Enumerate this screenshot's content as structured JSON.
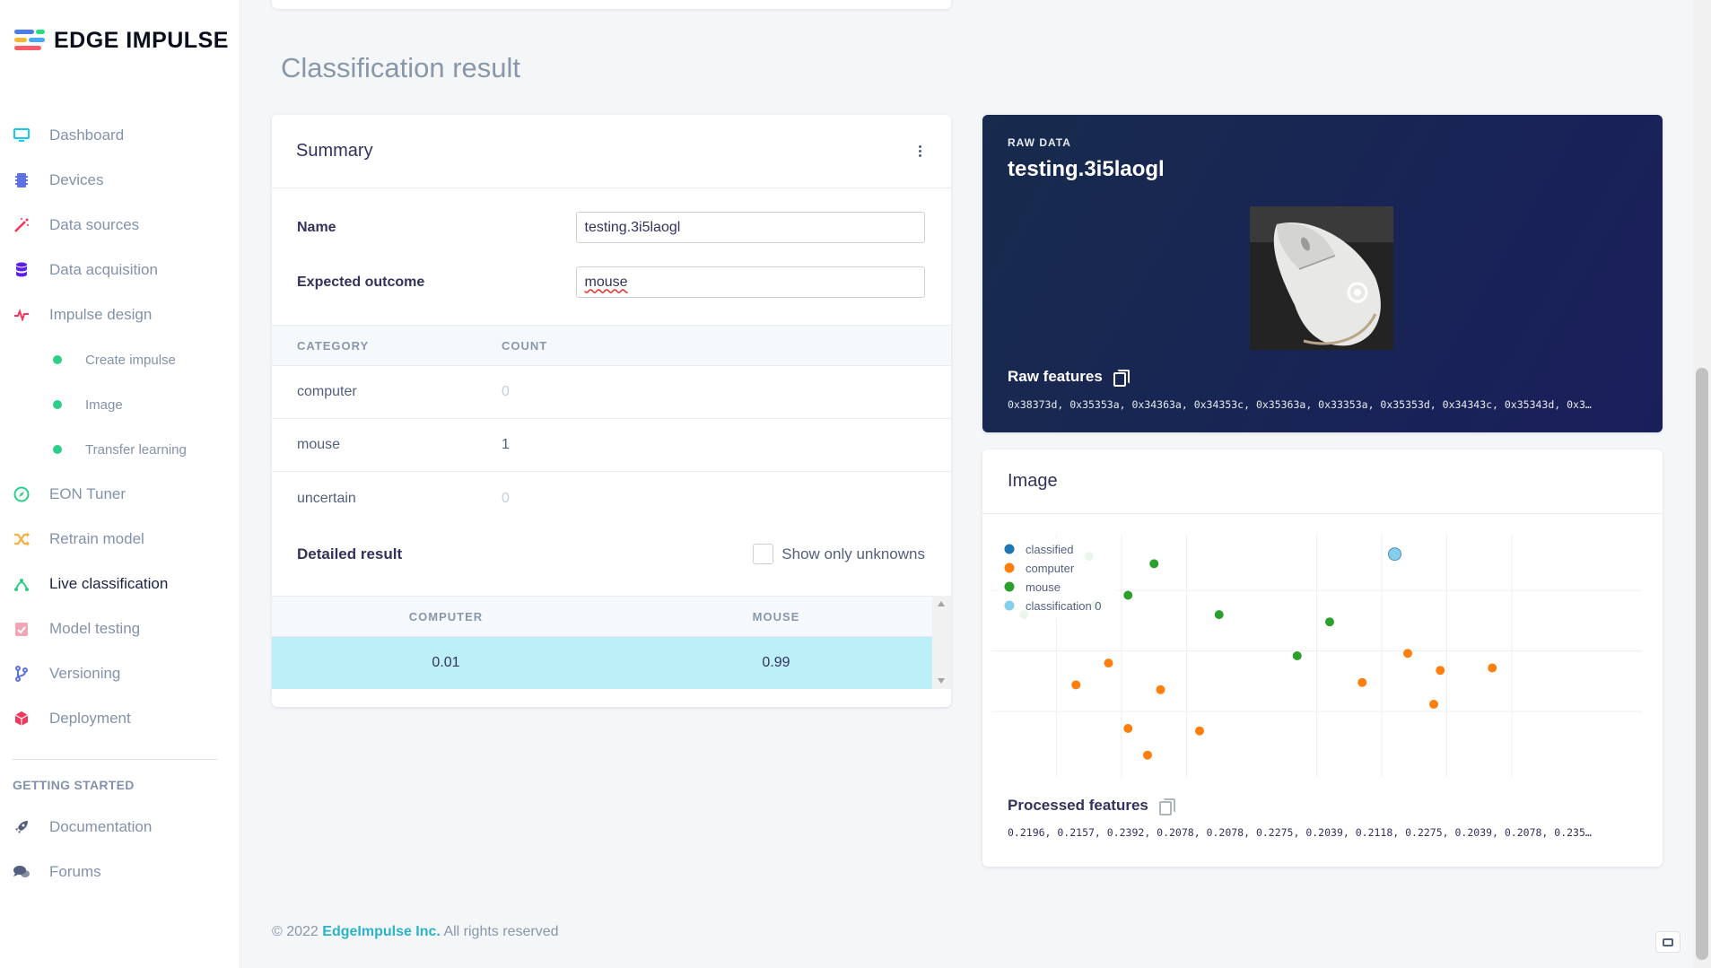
{
  "brand": {
    "name": "EDGE IMPULSE"
  },
  "sidebar": {
    "items": [
      {
        "label": "Dashboard",
        "icon": "monitor-icon",
        "color": "#11cdef"
      },
      {
        "label": "Devices",
        "icon": "chip-icon",
        "color": "#5e72e4"
      },
      {
        "label": "Data sources",
        "icon": "wand-icon",
        "color": "#f5365c"
      },
      {
        "label": "Data acquisition",
        "icon": "database-icon",
        "color": "#5e1fe4"
      },
      {
        "label": "Impulse design",
        "icon": "pulse-icon",
        "color": "#f5365c"
      }
    ],
    "subitems": [
      {
        "label": "Create impulse"
      },
      {
        "label": "Image"
      },
      {
        "label": "Transfer learning"
      }
    ],
    "items2": [
      {
        "label": "EON Tuner",
        "icon": "compass-icon",
        "color": "#2dce89"
      },
      {
        "label": "Retrain model",
        "icon": "shuffle-icon",
        "color": "#fbb140"
      },
      {
        "label": "Live classification",
        "icon": "nodes-icon",
        "color": "#2dce89"
      },
      {
        "label": "Model testing",
        "icon": "clipboard-check-icon",
        "color": "#f3a4b5"
      },
      {
        "label": "Versioning",
        "icon": "branch-icon",
        "color": "#5e72e4"
      },
      {
        "label": "Deployment",
        "icon": "cube-icon",
        "color": "#f5365c"
      }
    ],
    "section_title": "GETTING STARTED",
    "items3": [
      {
        "label": "Documentation",
        "icon": "rocket-icon",
        "color": "#525f7f"
      },
      {
        "label": "Forums",
        "icon": "chat-icon",
        "color": "#525f7f"
      }
    ]
  },
  "main": {
    "title": "Classification result",
    "summary": {
      "title": "Summary",
      "name_label": "Name",
      "name_value": "testing.3i5laogl",
      "expected_label": "Expected outcome",
      "expected_value": "mouse",
      "columns": [
        "CATEGORY",
        "COUNT"
      ],
      "rows": [
        {
          "category": "computer",
          "count": "0"
        },
        {
          "category": "mouse",
          "count": "1"
        },
        {
          "category": "uncertain",
          "count": "0"
        }
      ],
      "detailed_title": "Detailed result",
      "show_unknowns_label": "Show only unknowns",
      "show_unknowns_checked": false,
      "result_columns": [
        "COMPUTER",
        "MOUSE"
      ],
      "result_values": [
        "0.01",
        "0.99"
      ]
    },
    "raw": {
      "label": "RAW DATA",
      "title": "testing.3i5laogl",
      "features_title": "Raw features",
      "features": "0x38373d, 0x35353a, 0x34363a, 0x34353c, 0x35363a, 0x33353a, 0x35353d, 0x34343c, 0x35343d, 0x3…"
    },
    "image_card": {
      "title": "Image",
      "processed_title": "Processed features",
      "processed": "0.2196, 0.2157, 0.2392, 0.2078, 0.2078, 0.2275, 0.2039, 0.2118, 0.2275, 0.2039, 0.2078, 0.235…"
    }
  },
  "chart_data": {
    "type": "scatter",
    "grid": true,
    "legend_position": "top-left",
    "legend": [
      {
        "name": "classified",
        "color": "#1f77b4"
      },
      {
        "name": "computer",
        "color": "#ff7f0e"
      },
      {
        "name": "mouse",
        "color": "#2ca02c"
      },
      {
        "name": "classification 0",
        "color": "#87ceeb"
      }
    ],
    "series": [
      {
        "name": "computer",
        "color": "#ff7f0e",
        "points": [
          [
            0.13,
            0.62
          ],
          [
            0.18,
            0.53
          ],
          [
            0.21,
            0.8
          ],
          [
            0.24,
            0.91
          ],
          [
            0.26,
            0.64
          ],
          [
            0.32,
            0.81
          ],
          [
            0.57,
            0.61
          ],
          [
            0.64,
            0.49
          ],
          [
            0.68,
            0.7
          ],
          [
            0.69,
            0.56
          ],
          [
            0.77,
            0.55
          ]
        ]
      },
      {
        "name": "mouse",
        "color": "#2ca02c",
        "points": [
          [
            0.05,
            0.33
          ],
          [
            0.15,
            0.09
          ],
          [
            0.16,
            0.29
          ],
          [
            0.21,
            0.25
          ],
          [
            0.25,
            0.12
          ],
          [
            0.35,
            0.33
          ],
          [
            0.47,
            0.5
          ],
          [
            0.52,
            0.36
          ]
        ]
      },
      {
        "name": "classification 0",
        "color": "#87ceeb",
        "points": [
          [
            0.62,
            0.08
          ]
        ]
      }
    ]
  },
  "footer": {
    "copyright": "© 2022",
    "company": "EdgeImpulse Inc.",
    "rights": "All rights reserved"
  }
}
